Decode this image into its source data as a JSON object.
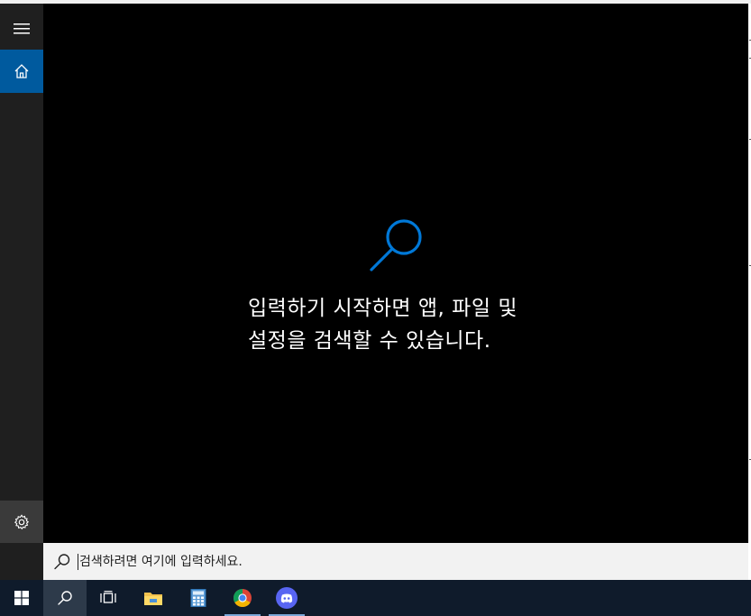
{
  "rail": {
    "menu_icon": "hamburger-menu-icon",
    "home_icon": "home-icon",
    "settings_icon": "gear-icon"
  },
  "panel": {
    "hint_line1": "입력하기 시작하면 앱, 파일 및",
    "hint_line2": "설정을 검색할 수 있습니다.",
    "hint_icon": "search-icon",
    "accent": "#0078d7"
  },
  "search": {
    "placeholder": "검색하려면 여기에 입력하세요.",
    "value": ""
  },
  "taskbar": {
    "items": [
      {
        "name": "start-button",
        "icon": "windows-logo-icon"
      },
      {
        "name": "search-button",
        "icon": "search-icon"
      },
      {
        "name": "task-view-button",
        "icon": "task-view-icon"
      },
      {
        "name": "file-explorer-button",
        "icon": "folder-icon"
      },
      {
        "name": "calculator-button",
        "icon": "calculator-icon"
      },
      {
        "name": "chrome-button",
        "icon": "chrome-icon"
      },
      {
        "name": "discord-button",
        "icon": "discord-icon"
      }
    ],
    "background": "#0f1b2b"
  }
}
